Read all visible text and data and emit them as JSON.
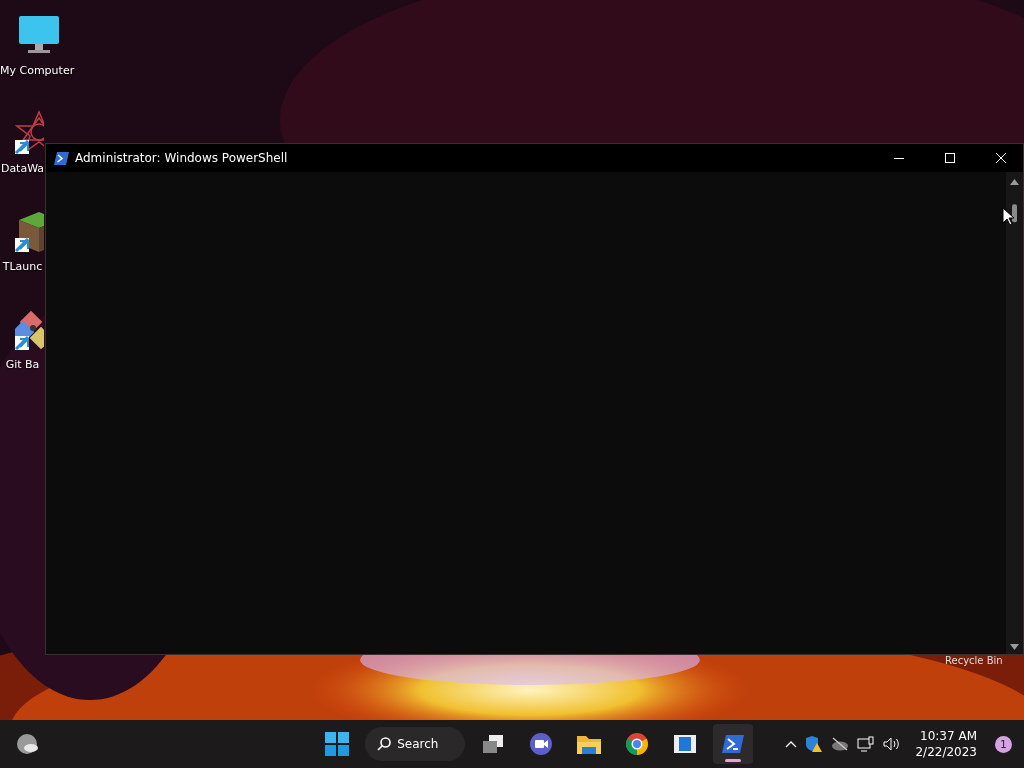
{
  "desktop_icons": [
    {
      "label": "My Computer",
      "kind": "computer",
      "shortcut": false
    },
    {
      "label": "DataWa",
      "kind": "datawarp",
      "shortcut": true
    },
    {
      "label": "TLaunc",
      "kind": "block",
      "shortcut": true
    },
    {
      "label": "Git Ba",
      "kind": "git",
      "shortcut": true
    }
  ],
  "recycle_bin": {
    "label": "Recycle Bin"
  },
  "window": {
    "title": "Administrator: Windows PowerShell"
  },
  "taskbar": {
    "search": "Search",
    "apps": [
      {
        "kind": "taskview",
        "selected": false
      },
      {
        "kind": "meet",
        "selected": false
      },
      {
        "kind": "explorer",
        "selected": false
      },
      {
        "kind": "chrome",
        "selected": false
      },
      {
        "kind": "notes",
        "selected": false
      },
      {
        "kind": "powershell",
        "selected": true
      }
    ],
    "clock": {
      "time": "10:37 AM",
      "date": "2/22/2023"
    },
    "notifications": "1"
  }
}
